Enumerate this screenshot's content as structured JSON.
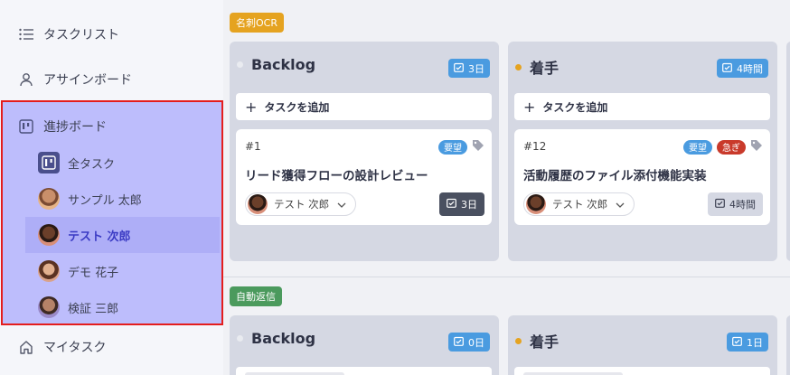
{
  "sidebar": {
    "items": [
      {
        "label": "タスクリスト",
        "icon": "list-icon"
      },
      {
        "label": "アサインボード",
        "icon": "user-icon"
      },
      {
        "label": "進捗ボード",
        "icon": "board-icon"
      },
      {
        "label": "マイタスク",
        "icon": "home-icon"
      }
    ],
    "progress_sub": [
      {
        "label": "全タスク",
        "icon": "board-icon"
      },
      {
        "label": "サンプル 太郎",
        "icon": "avatar"
      },
      {
        "label": "テスト 次郎",
        "icon": "avatar",
        "active": true
      },
      {
        "label": "デモ 花子",
        "icon": "avatar"
      },
      {
        "label": "検証 三郎",
        "icon": "avatar"
      }
    ]
  },
  "groups": [
    {
      "label": "名刺OCR",
      "color": "#e5a320",
      "columns": [
        {
          "title": "Backlog",
          "dot_color": "#e9ebf0",
          "badge": "3日",
          "add_label": "タスクを追加",
          "card": {
            "id": "#1",
            "tags": [
              {
                "label": "要望",
                "color": "#4a9be0"
              }
            ],
            "title": "リード獲得フローの設計レビュー",
            "assignee": "テスト 次郎",
            "estimate": "3日",
            "estimate_style": "dark"
          }
        },
        {
          "title": "着手",
          "dot_color": "#e5a320",
          "badge": "4時間",
          "add_label": "タスクを追加",
          "card": {
            "id": "#12",
            "tags": [
              {
                "label": "要望",
                "color": "#4a9be0"
              },
              {
                "label": "急ぎ",
                "color": "#c93a2b"
              }
            ],
            "title": "活動履歴のファイル添付機能実装",
            "assignee": "テスト 次郎",
            "estimate": "4時間",
            "estimate_style": "light"
          }
        }
      ]
    },
    {
      "label": "自動返信",
      "color": "#4b9a5d",
      "columns": [
        {
          "title": "Backlog",
          "dot_color": "#e9ebf0",
          "badge": "0日"
        },
        {
          "title": "着手",
          "dot_color": "#e5a320",
          "badge": "1日"
        }
      ]
    }
  ]
}
